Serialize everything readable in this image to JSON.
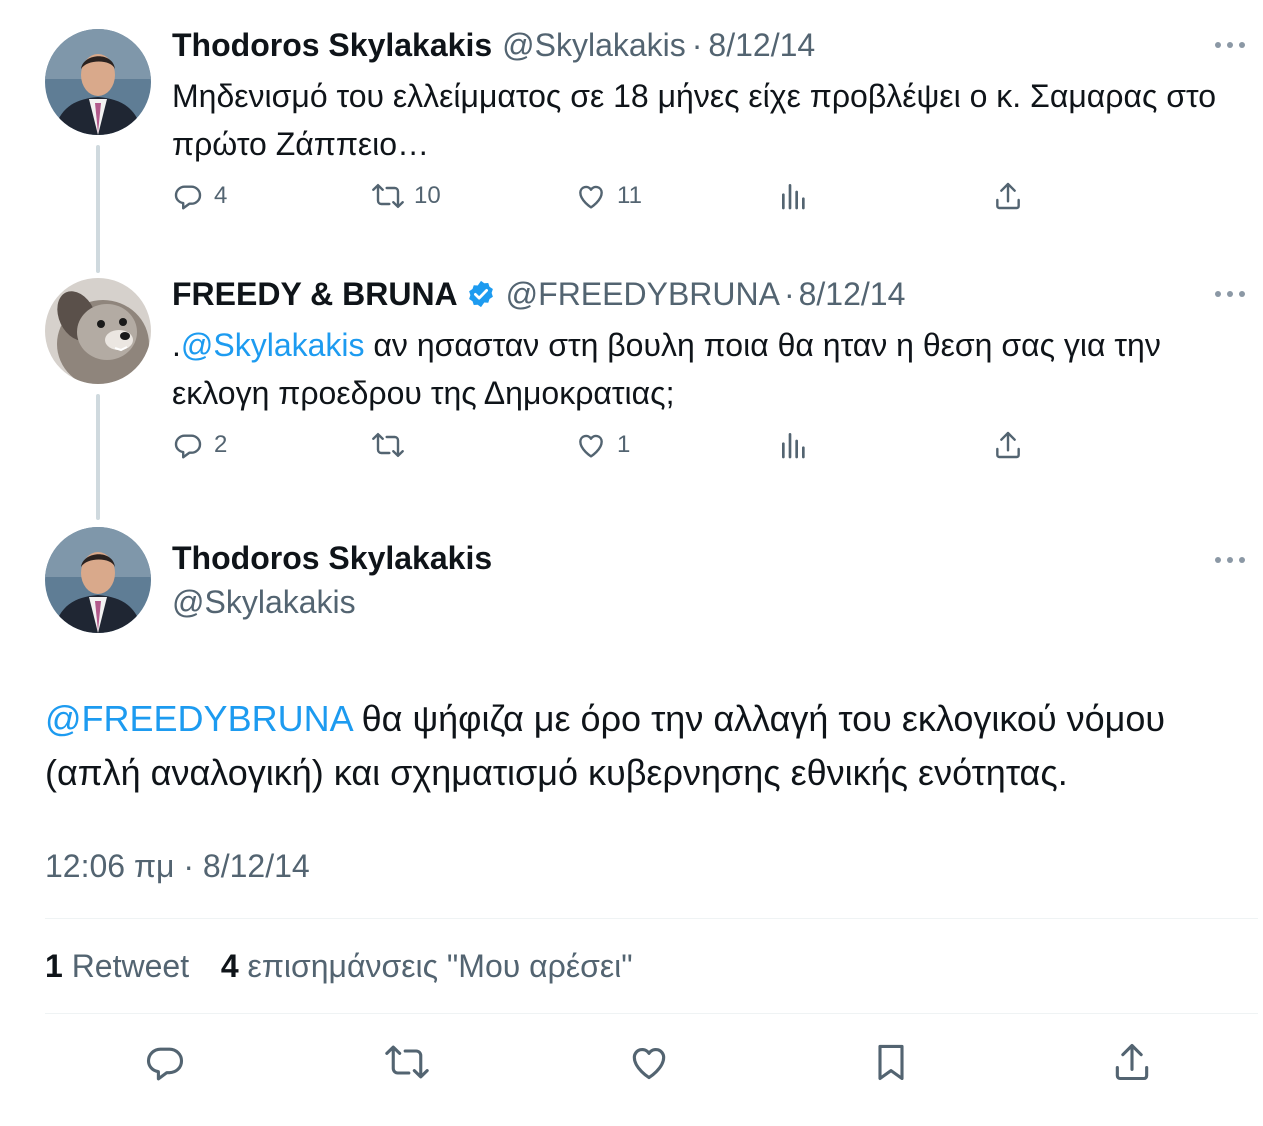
{
  "tweets": [
    {
      "name": "Thodoros Skylakakis",
      "handle": "@Skylakakis",
      "sep": "·",
      "date": "8/12/14",
      "text": "Μηδενισμό του ελλείμματος σε 18 μήνες είχε προβλέψει ο κ. Σαμαρας στο πρώτο Ζάππειο…",
      "replies": "4",
      "retweets": "10",
      "likes": "11",
      "icons": [
        "reply-icon",
        "retweet-icon",
        "like-icon",
        "views-icon",
        "share-icon"
      ]
    },
    {
      "name": "FREEDY & BRUNA",
      "verified": true,
      "handle": "@FREEDYBRUNA",
      "sep": "·",
      "date": "8/12/14",
      "text_prefix": ".",
      "mention": "@Skylakakis",
      "text": " αν ησασταν στη βουλη ποια θα ηταν η θεση σας για την εκλογη προεδρου της Δημοκρατιας;",
      "replies": "2",
      "retweets": "",
      "likes": "1"
    }
  ],
  "main": {
    "name": "Thodoros Skylakakis",
    "handle": "@Skylakakis",
    "mention": "@FREEDYBRUNA",
    "text": " θα ψήφιζα με όρο την αλλαγή του εκλογικού νόμου (απλή αναλογική) και σχηματισμό κυβερνησης εθνικής ενότητας.",
    "timestamp": "12:06 πμ · 8/12/14",
    "retweet_count": "1",
    "retweet_label": "Retweet",
    "like_count": "4",
    "like_label": "επισημάνσεις \"Μου αρέσει\"",
    "actions": [
      "reply-icon",
      "retweet-icon",
      "like-icon",
      "bookmark-icon",
      "share-icon"
    ]
  },
  "colors": {
    "accent": "#1d9bf0",
    "muted": "#536471",
    "text": "#0f1419"
  }
}
